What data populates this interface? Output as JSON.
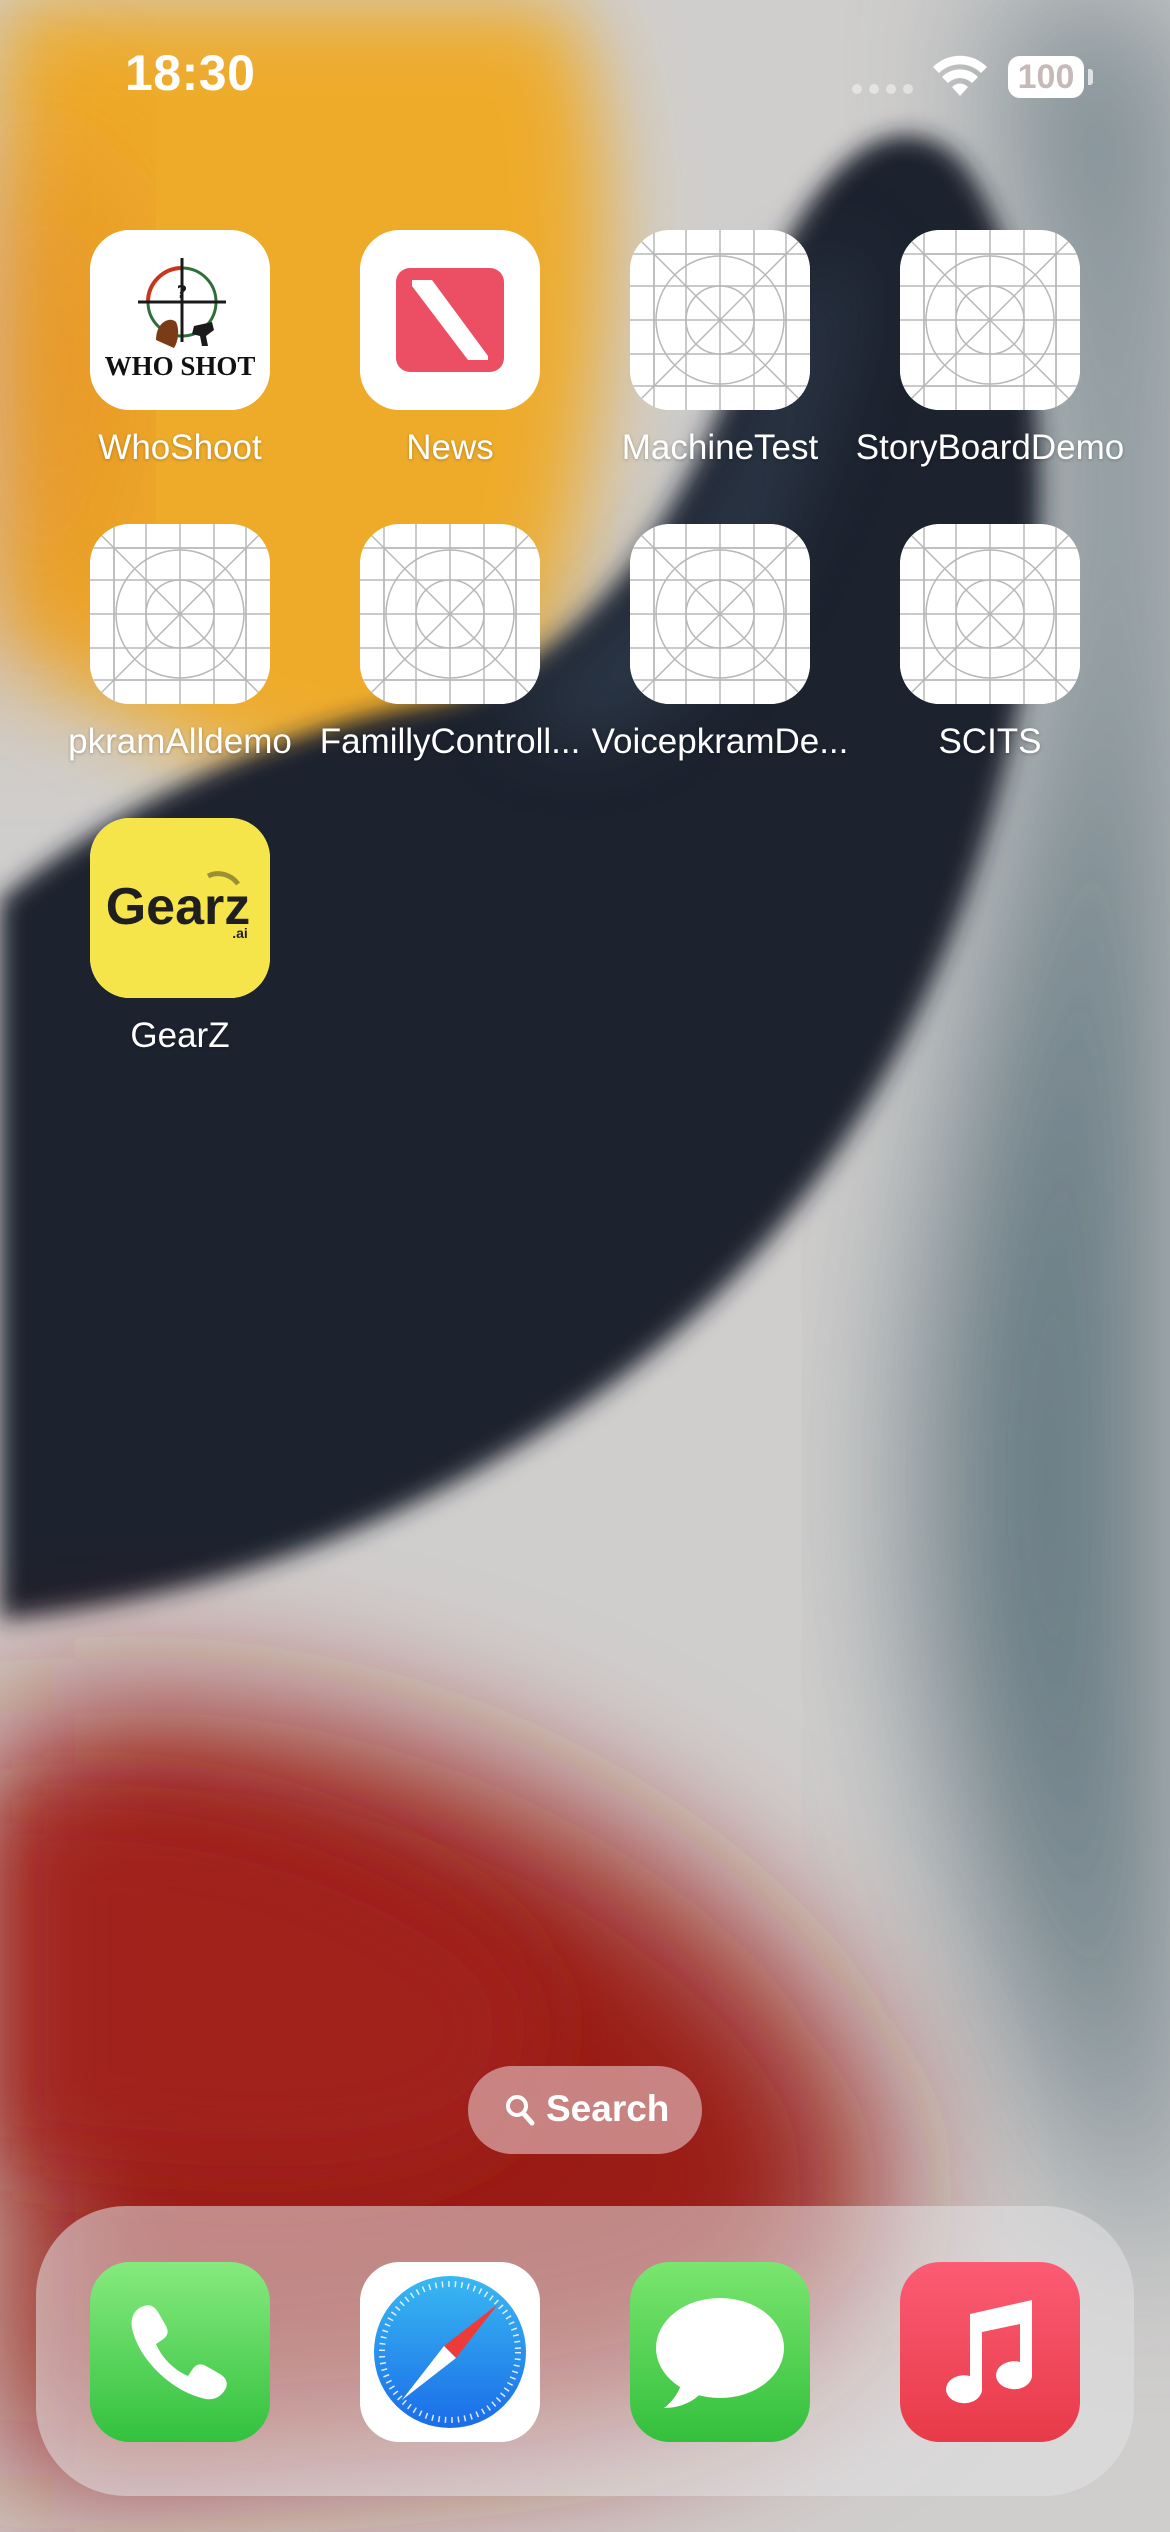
{
  "status_bar": {
    "time": "18:30",
    "battery": "100",
    "icons": [
      "signal-dots-icon",
      "wifi-icon",
      "battery-icon"
    ]
  },
  "apps": [
    {
      "label": "WhoShoot",
      "icon": "whoshoot-app-icon",
      "icon_text": "WHO SHOT"
    },
    {
      "label": "News",
      "icon": "news-app-icon"
    },
    {
      "label": "MachineTest",
      "icon": "placeholder-grid-icon"
    },
    {
      "label": "StoryBoardDemo",
      "icon": "placeholder-grid-icon"
    },
    {
      "label": "pkramAlldemo",
      "icon": "placeholder-grid-icon"
    },
    {
      "label": "FamillyControll...",
      "icon": "placeholder-grid-icon"
    },
    {
      "label": "VoicepkramDe...",
      "icon": "placeholder-grid-icon"
    },
    {
      "label": "SCITS",
      "icon": "placeholder-grid-icon"
    },
    {
      "label": "GearZ",
      "icon": "gearz-app-icon",
      "icon_text": "Gearz"
    }
  ],
  "search": {
    "label": "Search",
    "icon": "search-icon"
  },
  "dock": [
    {
      "name": "Phone",
      "icon": "phone-icon"
    },
    {
      "name": "Safari",
      "icon": "safari-compass-icon"
    },
    {
      "name": "Messages",
      "icon": "messages-bubble-icon"
    },
    {
      "name": "Music",
      "icon": "music-note-icon"
    }
  ],
  "colors": {
    "wallpaper_orange": "#eeac2c",
    "wallpaper_navy": "#1b2230",
    "wallpaper_red": "#9a1c18",
    "wallpaper_slate": "#4b6470",
    "gearz_yellow": "#f6e54a",
    "news_red": "#ec4f64",
    "phone_green": "#4fd05a",
    "music_red": "#f04658"
  }
}
